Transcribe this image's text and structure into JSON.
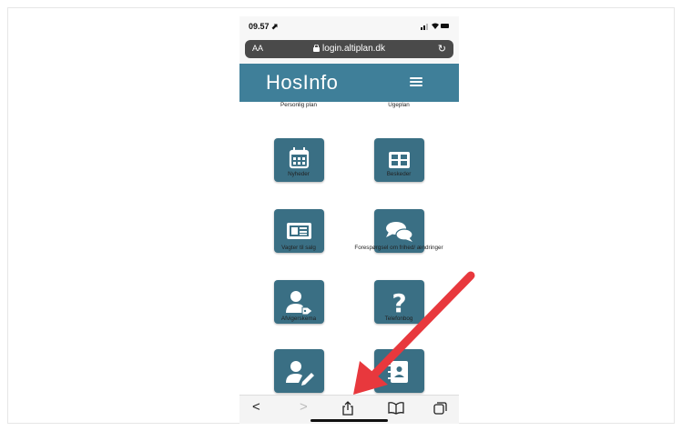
{
  "status_bar": {
    "time": "09.57 ⬈",
    "icons": "▪▪ ◠ ▬"
  },
  "browser": {
    "text_size": "AA",
    "url": "login.altiplan.dk",
    "lock": "🔒",
    "reload": "↻"
  },
  "app": {
    "brand": "HosInfo",
    "menu_icon": "hamburger-icon",
    "tiles": [
      {
        "label": "Personlig plan",
        "icon": "calendar-icon"
      },
      {
        "label": "Ugeplan",
        "icon": "week-grid-icon"
      },
      {
        "label": "Nyheder",
        "icon": "newspaper-icon"
      },
      {
        "label": "Beskeder",
        "icon": "chat-bubbles-icon"
      },
      {
        "label": "Vagter til salg",
        "icon": "user-tag-icon"
      },
      {
        "label": "Forespørgsel om frihed/ ændringer",
        "icon": "question-icon"
      },
      {
        "label": "Afvigerskema",
        "icon": "user-edit-icon"
      },
      {
        "label": "Telefonbog",
        "icon": "address-book-icon"
      }
    ],
    "tile_color": "#3a6f84",
    "header_color": "#3f7f99"
  },
  "toolbar": {
    "back": "<",
    "forward": ">",
    "share": "⇪",
    "bookmarks": "📖",
    "tabs": "⧉"
  },
  "annotation": {
    "arrow_color": "#e8383d"
  }
}
